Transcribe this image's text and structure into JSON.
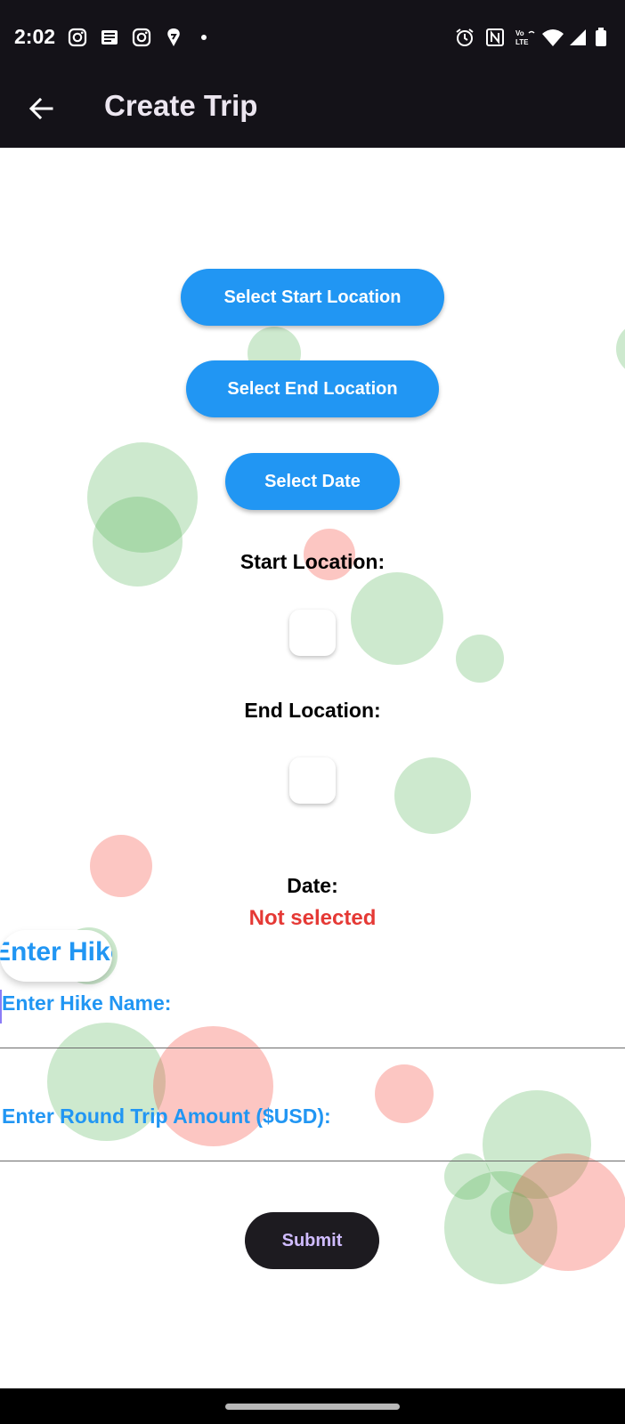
{
  "status_bar": {
    "time": "2:02",
    "left_icons": [
      "instagram-icon",
      "news-icon",
      "instagram-icon",
      "swiggy-icon",
      "dot-icon"
    ],
    "right_icons": [
      "alarm-icon",
      "nfc-icon",
      "volte-icon",
      "wifi-icon",
      "signal-icon",
      "battery-icon"
    ]
  },
  "app_bar": {
    "title": "Create Trip",
    "back_icon": "arrow-back-icon"
  },
  "buttons": {
    "select_start": "Select Start Location",
    "select_end": "Select End Location",
    "select_date": "Select Date",
    "submit": "Submit"
  },
  "labels": {
    "start_location": "Start Location:",
    "end_location": "End Location:",
    "date": "Date:",
    "date_value": "Not selected"
  },
  "marquee": {
    "text": "Enter Hike"
  },
  "fields": {
    "hike_name": {
      "label": "Enter Hike Name:",
      "value": ""
    },
    "round_trip": {
      "label": "Enter Round Trip Amount ($USD):",
      "value": ""
    }
  },
  "colors": {
    "primary": "#2196f3",
    "bar_bg": "#141218",
    "submit_bg": "#1d1b20",
    "submit_text": "#d0bcff",
    "error": "#e53935"
  }
}
